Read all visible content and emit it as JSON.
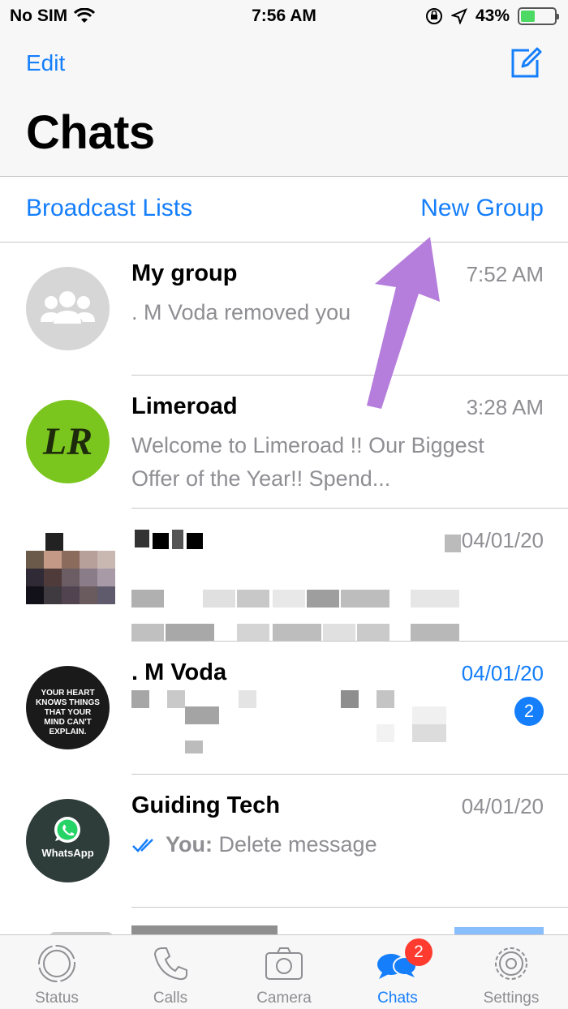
{
  "status_bar": {
    "carrier": "No SIM",
    "time": "7:56 AM",
    "battery_percent": "43%",
    "battery_level": 0.43
  },
  "header": {
    "edit_label": "Edit",
    "title": "Chats",
    "compose_icon": "compose-icon"
  },
  "links": {
    "broadcast_label": "Broadcast Lists",
    "new_group_label": "New Group"
  },
  "chats": [
    {
      "name": "My group",
      "time": "7:52 AM",
      "preview": ". M Voda removed you"
    },
    {
      "name": "Limeroad",
      "time": "3:28 AM",
      "preview": "Welcome to Limeroad !! Our Biggest Offer of the Year!! Spend...",
      "avatar_text": "LR"
    },
    {
      "name": "",
      "time": "04/01/20",
      "preview": ""
    },
    {
      "name": ". M Voda",
      "time": "04/01/20",
      "preview": "",
      "unread": "2",
      "avatar_text": "YOUR HEART KNOWS THINGS THAT YOUR MIND CAN'T EXPLAIN."
    },
    {
      "name": "Guiding Tech",
      "time": "04/01/20",
      "preview_sender": "You:",
      "preview": " Delete message",
      "avatar_text": "WhatsApp"
    }
  ],
  "tabbar": {
    "tabs": [
      {
        "label": "Status",
        "icon": "status-icon"
      },
      {
        "label": "Calls",
        "icon": "phone-icon"
      },
      {
        "label": "Camera",
        "icon": "camera-icon"
      },
      {
        "label": "Chats",
        "icon": "chat-bubbles-icon",
        "badge": "2"
      },
      {
        "label": "Settings",
        "icon": "gear-icon"
      }
    ]
  },
  "colors": {
    "accent": "#147efb",
    "badge_red": "#ff3b30",
    "arrow": "#b57edc"
  }
}
